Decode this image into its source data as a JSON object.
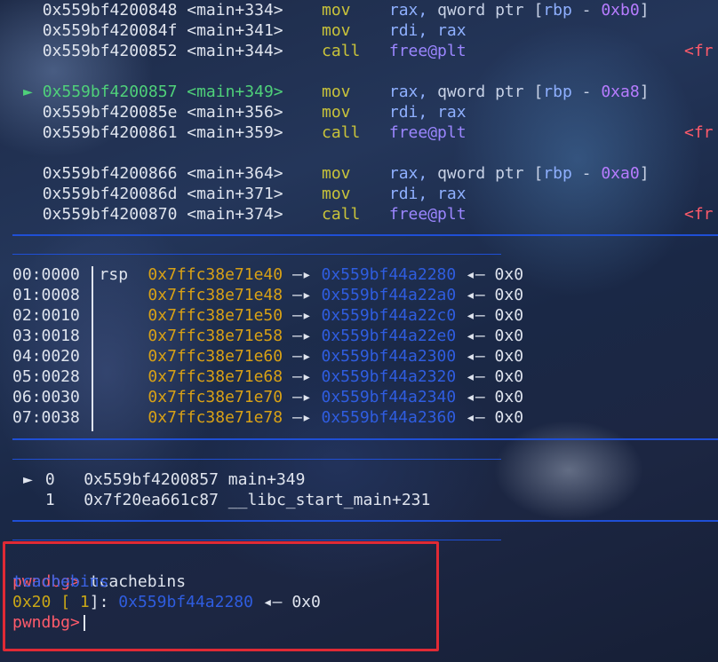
{
  "disasm": [
    {
      "addr": "0x559bf4200848",
      "sym": "<main+334>",
      "mnem": "mov",
      "op1": "rax,",
      "op2": "qword ptr [rbp - 0xb0]",
      "dest": ""
    },
    {
      "addr": "0x559bf420084f",
      "sym": "<main+341>",
      "mnem": "mov",
      "op1": "rdi,",
      "op2": "rax",
      "dest": ""
    },
    {
      "addr": "0x559bf4200852",
      "sym": "<main+344>",
      "mnem": "call",
      "op1": "free@plt",
      "op2": "",
      "dest": "<fr"
    },
    {
      "addr": "0x559bf4200857",
      "sym": "<main+349>",
      "mnem": "mov",
      "op1": "rax,",
      "op2": "qword ptr [rbp - 0xa8]",
      "dest": "",
      "current": true,
      "marker": "►"
    },
    {
      "addr": "0x559bf420085e",
      "sym": "<main+356>",
      "mnem": "mov",
      "op1": "rdi,",
      "op2": "rax",
      "dest": ""
    },
    {
      "addr": "0x559bf4200861",
      "sym": "<main+359>",
      "mnem": "call",
      "op1": "free@plt",
      "op2": "",
      "dest": "<fr"
    },
    {
      "addr": "0x559bf4200866",
      "sym": "<main+364>",
      "mnem": "mov",
      "op1": "rax,",
      "op2": "qword ptr [rbp - 0xa0]",
      "dest": ""
    },
    {
      "addr": "0x559bf420086d",
      "sym": "<main+371>",
      "mnem": "mov",
      "op1": "rdi,",
      "op2": "rax",
      "dest": ""
    },
    {
      "addr": "0x559bf4200870",
      "sym": "<main+374>",
      "mnem": "call",
      "op1": "free@plt",
      "op2": "",
      "dest": "<fr"
    }
  ],
  "stack": [
    {
      "idx": "00:0000",
      "reg": "rsp",
      "saddr": "0x7ffc38e71e40",
      "arrow": "—▸",
      "haddr": "0x559bf44a2280",
      "tail": "◂— 0x0"
    },
    {
      "idx": "01:0008",
      "reg": "",
      "saddr": "0x7ffc38e71e48",
      "arrow": "—▸",
      "haddr": "0x559bf44a22a0",
      "tail": "◂— 0x0"
    },
    {
      "idx": "02:0010",
      "reg": "",
      "saddr": "0x7ffc38e71e50",
      "arrow": "—▸",
      "haddr": "0x559bf44a22c0",
      "tail": "◂— 0x0"
    },
    {
      "idx": "03:0018",
      "reg": "",
      "saddr": "0x7ffc38e71e58",
      "arrow": "—▸",
      "haddr": "0x559bf44a22e0",
      "tail": "◂— 0x0"
    },
    {
      "idx": "04:0020",
      "reg": "",
      "saddr": "0x7ffc38e71e60",
      "arrow": "—▸",
      "haddr": "0x559bf44a2300",
      "tail": "◂— 0x0"
    },
    {
      "idx": "05:0028",
      "reg": "",
      "saddr": "0x7ffc38e71e68",
      "arrow": "—▸",
      "haddr": "0x559bf44a2320",
      "tail": "◂— 0x0"
    },
    {
      "idx": "06:0030",
      "reg": "",
      "saddr": "0x7ffc38e71e70",
      "arrow": "—▸",
      "haddr": "0x559bf44a2340",
      "tail": "◂— 0x0"
    },
    {
      "idx": "07:0038",
      "reg": "",
      "saddr": "0x7ffc38e71e78",
      "arrow": "—▸",
      "haddr": "0x559bf44a2360",
      "tail": "◂— 0x0"
    }
  ],
  "backtrace": [
    {
      "marker": "►",
      "num": "0",
      "addr": "0x559bf4200857",
      "sym": "main+349"
    },
    {
      "marker": "",
      "num": "1",
      "addr": "0x7f20ea661c87",
      "sym": "__libc_start_main+231"
    }
  ],
  "console": {
    "prompt": "pwndbg>",
    "command": "tcachebins",
    "header": "tcachebins",
    "bin_size": "0x20",
    "bin_count_open": "[",
    "bin_count": "1",
    "bin_count_close": "]:",
    "bin_addr": "0x559bf44a2280",
    "bin_tail": "◂— 0x0",
    "prompt2": "pwndbg>"
  },
  "colors": {
    "highlight_border": "#e02a35",
    "separator": "#1f4fd6",
    "prompt": "#ff5b6b",
    "stack_addr": "#d8a116",
    "heap_addr": "#2f5de0"
  }
}
